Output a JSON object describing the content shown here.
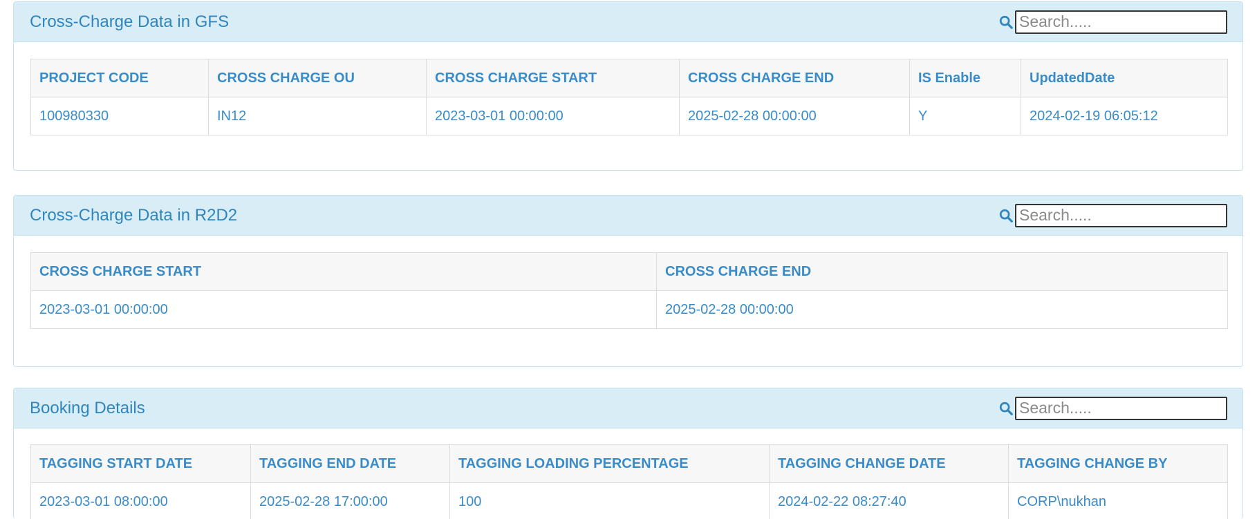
{
  "search_placeholder": "Search.....",
  "panels": [
    {
      "title": "Cross-Charge Data in GFS",
      "columns": [
        "PROJECT CODE",
        "CROSS CHARGE OU",
        "CROSS CHARGE START",
        "CROSS CHARGE END",
        "IS Enable",
        "UpdatedDate"
      ],
      "rows": [
        [
          "100980330",
          "IN12",
          "2023-03-01 00:00:00",
          "2025-02-28 00:00:00",
          "Y",
          "2024-02-19 06:05:12"
        ]
      ]
    },
    {
      "title": "Cross-Charge Data in R2D2",
      "columns": [
        "CROSS CHARGE START",
        "CROSS CHARGE END"
      ],
      "rows": [
        [
          "2023-03-01 00:00:00",
          "2025-02-28 00:00:00"
        ]
      ]
    },
    {
      "title": "Booking Details",
      "columns": [
        "TAGGING START DATE",
        "TAGGING END DATE",
        "TAGGING LOADING PERCENTAGE",
        "TAGGING CHANGE DATE",
        "TAGGING CHANGE BY"
      ],
      "rows": [
        [
          "2023-03-01 08:00:00",
          "2025-02-28 17:00:00",
          "100",
          "2024-02-22 08:27:40",
          "CORP\\nukhan"
        ]
      ]
    }
  ],
  "colors": {
    "header_bg": "#d9edf7",
    "text": "#3a8cc8",
    "border": "#c4e2ee"
  },
  "icons": {
    "search": "search-icon"
  }
}
